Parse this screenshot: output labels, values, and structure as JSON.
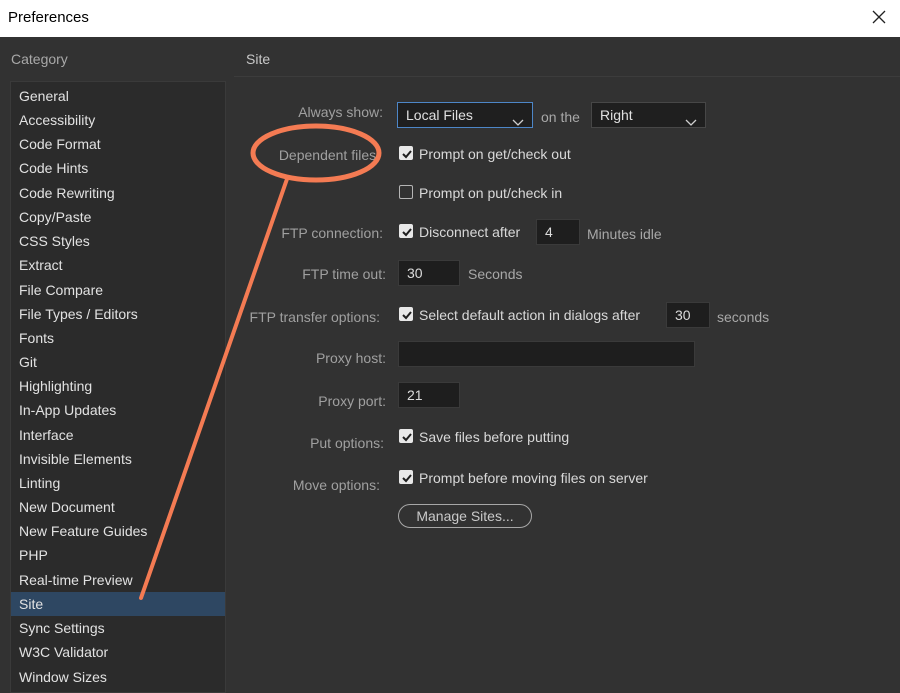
{
  "window": {
    "title": "Preferences"
  },
  "category_header": "Category",
  "panel_header": "Site",
  "categories": [
    "General",
    "Accessibility",
    "Code Format",
    "Code Hints",
    "Code Rewriting",
    "Copy/Paste",
    "CSS Styles",
    "Extract",
    "File Compare",
    "File Types / Editors",
    "Fonts",
    "Git",
    "Highlighting",
    "In-App Updates",
    "Interface",
    "Invisible Elements",
    "Linting",
    "New Document",
    "New Feature Guides",
    "PHP",
    "Real-time Preview",
    "Site",
    "Sync Settings",
    "W3C Validator",
    "Window Sizes"
  ],
  "selected_category": "Site",
  "site": {
    "always_show_label": "Always show:",
    "always_show_value": "Local Files",
    "on_the": "on the",
    "side_value": "Right",
    "dependent_label": "Dependent files:",
    "prompt_get": "Prompt on get/check out",
    "prompt_get_checked": true,
    "prompt_put": "Prompt on put/check in",
    "prompt_put_checked": false,
    "ftp_conn_label": "FTP connection:",
    "disconnect_after": "Disconnect after",
    "disconnect_checked": true,
    "disconnect_minutes": "4",
    "minutes_idle": "Minutes idle",
    "ftp_timeout_label": "FTP time out:",
    "ftp_timeout_value": "30",
    "seconds": "Seconds",
    "ftp_transfer_label": "FTP transfer options:",
    "select_default": "Select default action in dialogs after",
    "select_default_checked": true,
    "transfer_seconds_value": "30",
    "seconds_lower": "seconds",
    "proxy_host_label": "Proxy host:",
    "proxy_host_value": "",
    "proxy_port_label": "Proxy port:",
    "proxy_port_value": "21",
    "put_options_label": "Put options:",
    "save_before_putting": "Save files before putting",
    "save_before_checked": true,
    "move_options_label": "Move options:",
    "prompt_before_moving": "Prompt before moving files on server",
    "prompt_moving_checked": true,
    "manage_sites": "Manage Sites..."
  },
  "colors": {
    "annotation": "#f47b53",
    "selected_row": "#2e4762",
    "panel_bg": "#323232"
  }
}
